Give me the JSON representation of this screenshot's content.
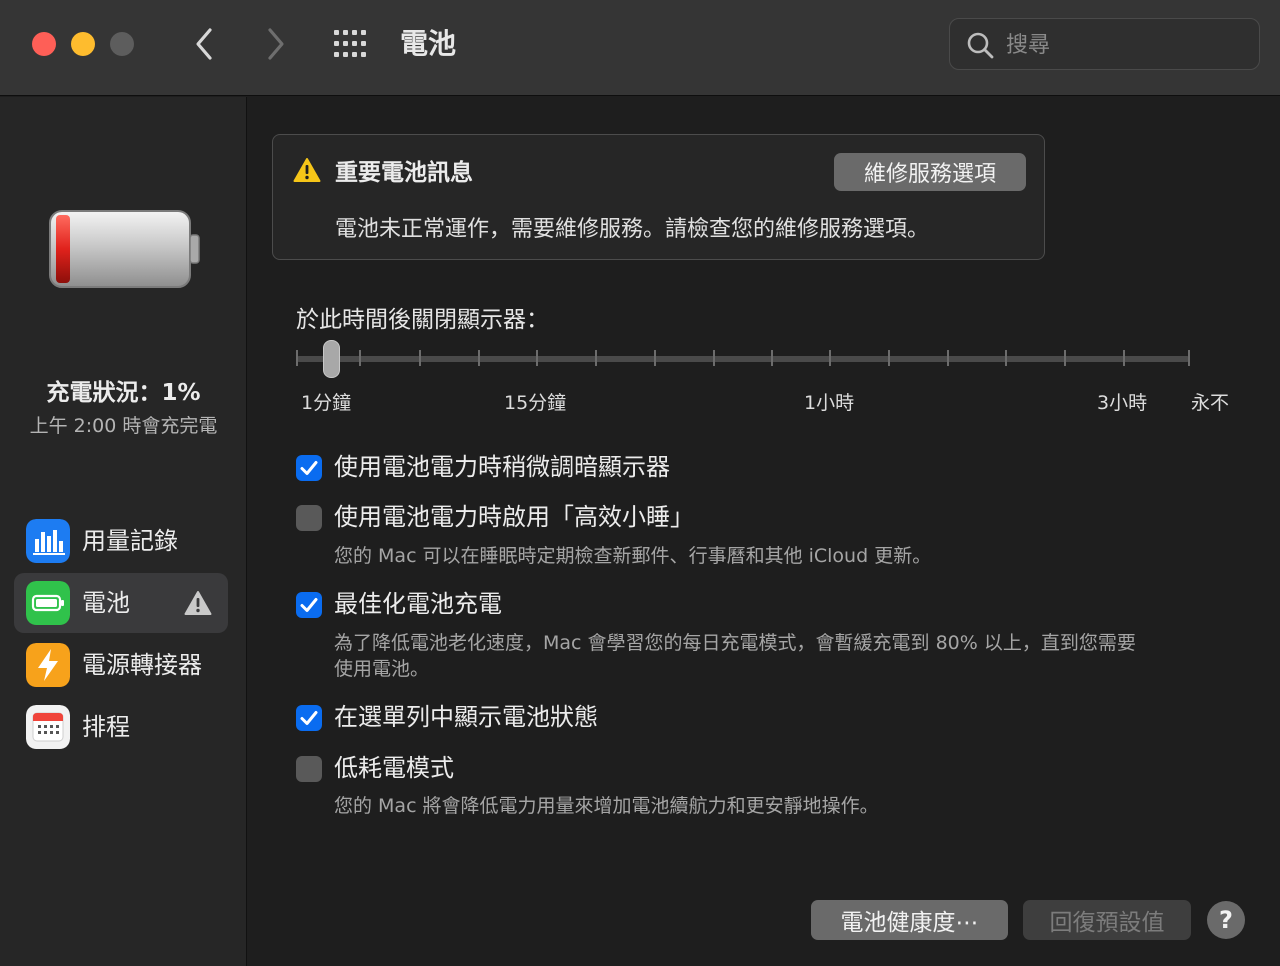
{
  "window": {
    "title": "電池"
  },
  "search": {
    "placeholder": "搜尋",
    "value": ""
  },
  "sidebar": {
    "status_label": "充電狀況：1%",
    "status_sub": "上午 2:00 時會充完電",
    "items": [
      {
        "label": "用量記錄",
        "icon": "bar-chart-icon",
        "color": "#1d7cf2"
      },
      {
        "label": "電池",
        "icon": "battery-icon",
        "color": "#30c24b",
        "selected": true,
        "warning": true
      },
      {
        "label": "電源轉接器",
        "icon": "bolt-icon",
        "color": "#f7a21b"
      },
      {
        "label": "排程",
        "icon": "calendar-icon",
        "color": "#f2f2f2"
      }
    ]
  },
  "alert": {
    "title": "重要電池訊息",
    "body": "電池未正常運作，需要維修服務。請檢查您的維修服務選項。",
    "button": "維修服務選項"
  },
  "display_sleep": {
    "label": "於此時間後關閉顯示器：",
    "ticks": [
      "1分鐘",
      "15分鐘",
      "1小時",
      "3小時",
      "永不"
    ],
    "value_label": "1分鐘"
  },
  "options": [
    {
      "label": "使用電池電力時稍微調暗顯示器",
      "checked": true,
      "desc": ""
    },
    {
      "label": "使用電池電力時啟用「高效小睡」",
      "checked": false,
      "desc": "您的 Mac 可以在睡眠時定期檢查新郵件、行事曆和其他 iCloud 更新。"
    },
    {
      "label": "最佳化電池充電",
      "checked": true,
      "desc_line1": "為了降低電池老化速度，Mac 會學習您的每日充電模式，會暫緩充電到 80% 以上，直到您需要",
      "desc_line2": "使用電池。"
    },
    {
      "label": "在選單列中顯示電池狀態",
      "checked": true,
      "desc": ""
    },
    {
      "label": "低耗電模式",
      "checked": false,
      "desc": "您的 Mac 將會降低電力用量來增加電池續航力和更安靜地操作。"
    }
  ],
  "footer": {
    "health_button": "電池健康度⋯",
    "restore_button": "回復預設值",
    "help_button": "?"
  },
  "colors": {
    "accent": "#0a6cf0",
    "warning": "#f5c518",
    "battery_low": "#e0221c"
  }
}
